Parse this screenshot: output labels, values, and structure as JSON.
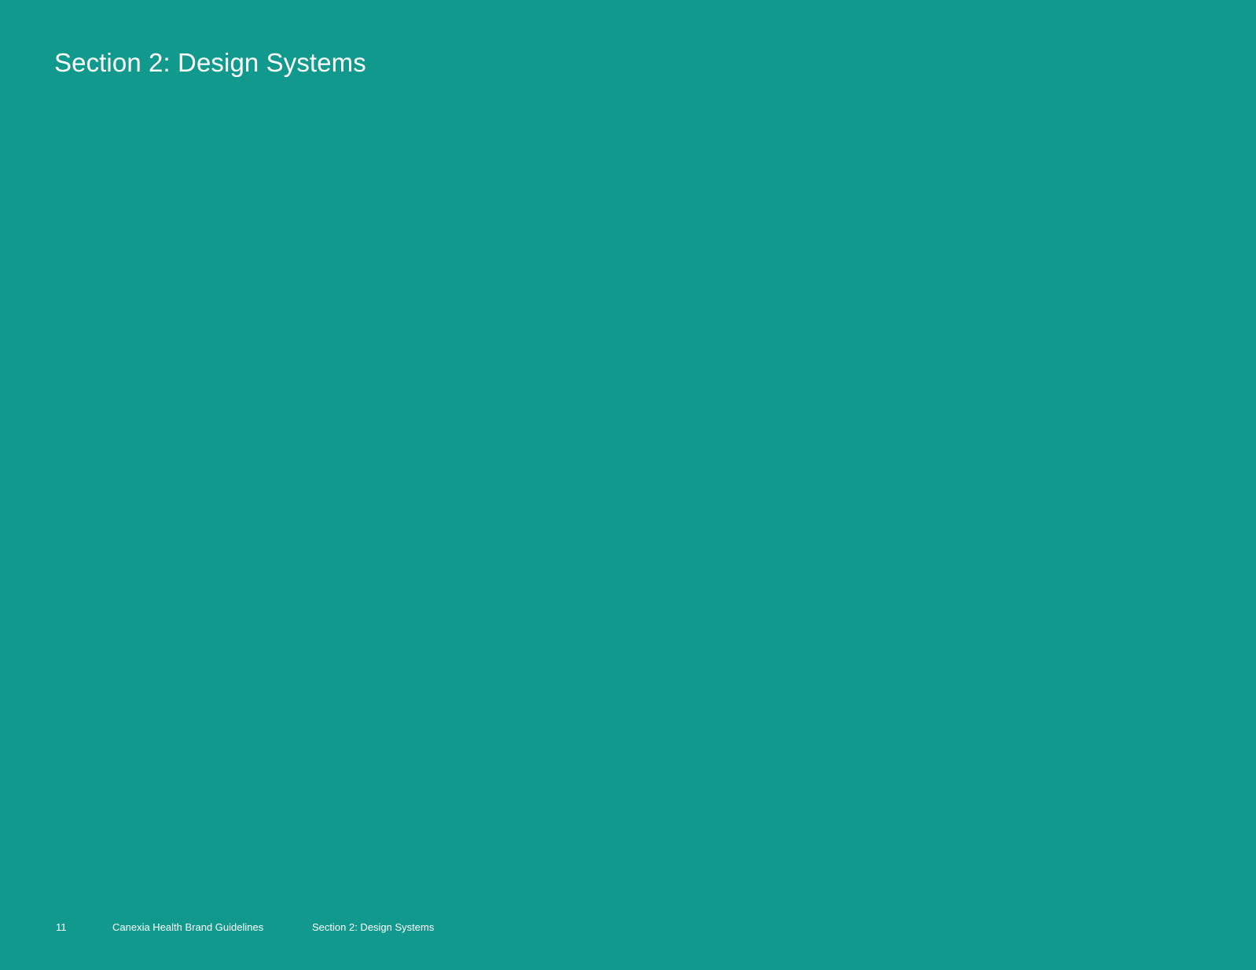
{
  "page": {
    "background_color": "#12998e",
    "text_color": "#ffffff",
    "title": "Section 2: Design Systems"
  },
  "footer": {
    "page_number": "11",
    "document_title": "Canexia Health Brand Guidelines",
    "section_title": "Section 2: Design Systems"
  }
}
